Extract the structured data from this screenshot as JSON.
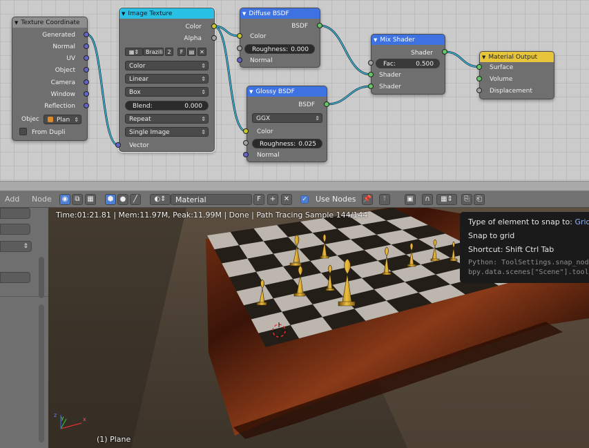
{
  "nodes": {
    "texture_coordinate": {
      "title": "Texture Coordinate",
      "outputs": [
        "Generated",
        "Normal",
        "UV",
        "Object",
        "Camera",
        "Window",
        "Reflection"
      ],
      "object_label": "Objec",
      "object_value": "Plan",
      "from_dupli": "From Dupli"
    },
    "image_texture": {
      "title": "Image Texture",
      "outputs": [
        "Color",
        "Alpha"
      ],
      "image_name": "Brazili",
      "image_users": "2",
      "fake_user": "F",
      "color_mode": "Color",
      "interpolation": "Linear",
      "projection": "Box",
      "blend_label": "Blend:",
      "blend_value": "0.000",
      "extension": "Repeat",
      "source": "Single Image",
      "vector_input": "Vector"
    },
    "diffuse": {
      "title": "Diffuse BSDF",
      "output": "BSDF",
      "color": "Color",
      "roughness_label": "Roughness:",
      "roughness_value": "0.000",
      "normal": "Normal"
    },
    "glossy": {
      "title": "Glossy BSDF",
      "output": "BSDF",
      "distribution": "GGX",
      "color": "Color",
      "roughness_label": "Roughness:",
      "roughness_value": "0.025",
      "normal": "Normal"
    },
    "mix": {
      "title": "Mix Shader",
      "output": "Shader",
      "fac_label": "Fac:",
      "fac_value": "0.500",
      "shader1": "Shader",
      "shader2": "Shader"
    },
    "output": {
      "title": "Material Output",
      "surface": "Surface",
      "volume": "Volume",
      "displacement": "Displacement"
    }
  },
  "header": {
    "add_menu": "Add",
    "node_menu": "Node",
    "material_name": "Material",
    "fake_user": "F",
    "use_nodes_label": "Use Nodes",
    "use_nodes_checked": true
  },
  "viewport": {
    "stats": "Time:01:21.81 | Mem:11.97M, Peak:11.99M | Done | Path Tracing Sample 144/144",
    "object_label": "(1) Plane",
    "axis_x": "x",
    "axis_y": "y",
    "axis_z": "z"
  },
  "tooltip": {
    "title_prefix": "Type of element to snap to:",
    "title_value": "Grid",
    "desc": "Snap to grid",
    "shortcut": "Shortcut: Shift Ctrl Tab",
    "python1": "Python: ToolSettings.snap_nod",
    "python2": "bpy.data.scenes[\"Scene\"].tool"
  },
  "colors": {
    "node_editor_bg": "#cbcbcb",
    "wire": "#3ab6d6",
    "image_texture_header": "#29c1e3",
    "shader_header": "#3e72e0",
    "output_header": "#e6c53a",
    "socket_vector": "#6363c7",
    "socket_color": "#c7c729",
    "socket_shader": "#63c763"
  }
}
